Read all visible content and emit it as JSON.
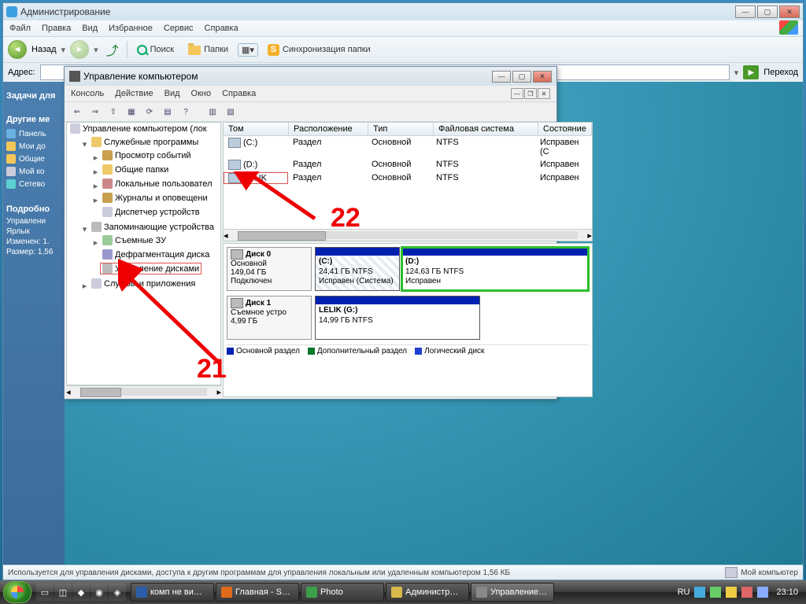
{
  "outer": {
    "title": "Администрирование",
    "menu": [
      "Файл",
      "Правка",
      "Вид",
      "Избранное",
      "Сервис",
      "Справка"
    ],
    "toolbar": {
      "back": "Назад",
      "search": "Поиск",
      "folders": "Папки",
      "sync": "Синхронизация папки"
    },
    "address_label": "Адрес:",
    "go": "Переход",
    "tasks_header": "Задачи для",
    "other_header": "Другие ме",
    "left_items": [
      "Панель",
      "Мои до",
      "Общие",
      "Мой ко",
      "Сетево"
    ],
    "details_header": "Подробно",
    "details": {
      "name": "Управлени",
      "type": "Ярлык",
      "changed": "Изменен: 1.",
      "size": "Размер: 1,56"
    },
    "status": "Используется для управления дисками, доступа к другим программам для управления локальным или удаленным компьютером 1,56 КБ",
    "status_right": "Мой компьютер"
  },
  "inner": {
    "title": "Управление компьютером",
    "menu": [
      "Консоль",
      "Действие",
      "Вид",
      "Окно",
      "Справка"
    ],
    "tree": {
      "root": "Управление компьютером (лок",
      "sys": "Служебные программы",
      "sys_items": [
        "Просмотр событий",
        "Общие папки",
        "Локальные пользовател",
        "Журналы и оповещени",
        "Диспетчер устройств"
      ],
      "storage": "Запоминающие устройства",
      "storage_items": [
        "Съемные ЗУ",
        "Дефрагментация диска",
        "Управление дисками"
      ],
      "services": "Службы и приложения"
    },
    "columns": {
      "tom": "Том",
      "ras": "Расположение",
      "tip": "Тип",
      "fs": "Файловая система",
      "st": "Состояние"
    },
    "volumes": [
      {
        "name": "(C:)",
        "ras": "Раздел",
        "tip": "Основной",
        "fs": "NTFS",
        "st": "Исправен (С"
      },
      {
        "name": "(D:)",
        "ras": "Раздел",
        "tip": "Основной",
        "fs": "NTFS",
        "st": "Исправен"
      },
      {
        "name": "LELIK",
        "ras": "Раздел",
        "tip": "Основной",
        "fs": "NTFS",
        "st": "Исправен"
      }
    ],
    "disk0": {
      "label": "Диск 0",
      "type": "Основной",
      "size": "149,04 ГБ",
      "state": "Подключен",
      "parts": [
        {
          "name": "(C:)",
          "size": "24,41 ГБ NTFS",
          "state": "Исправен (Система)"
        },
        {
          "name": "(D:)",
          "size": "124,63 ГБ NTFS",
          "state": "Исправен"
        }
      ]
    },
    "disk1": {
      "label": "Диск 1",
      "type": "Съемное устро",
      "size": "4,99 ГБ",
      "state": "",
      "parts": [
        {
          "name": "LELIK  (G:)",
          "size": "14,99 ГБ NTFS",
          "state": ""
        }
      ]
    },
    "legend": {
      "primary": "Основной раздел",
      "extended": "Дополнительный раздел",
      "logical": "Логический диск"
    }
  },
  "annotations": {
    "top": "22",
    "bottom": "21"
  },
  "taskbar": {
    "items": [
      {
        "label": "комп не ви…",
        "icon": "#2a5ea8"
      },
      {
        "label": "Главная - S…",
        "icon": "#e06a1a"
      },
      {
        "label": "Photo",
        "icon": "#3aa04a"
      },
      {
        "label": "Администр…",
        "icon": "#d8b84a"
      },
      {
        "label": "Управление…",
        "icon": "#888"
      }
    ],
    "lang": "RU",
    "clock": "23:10"
  }
}
